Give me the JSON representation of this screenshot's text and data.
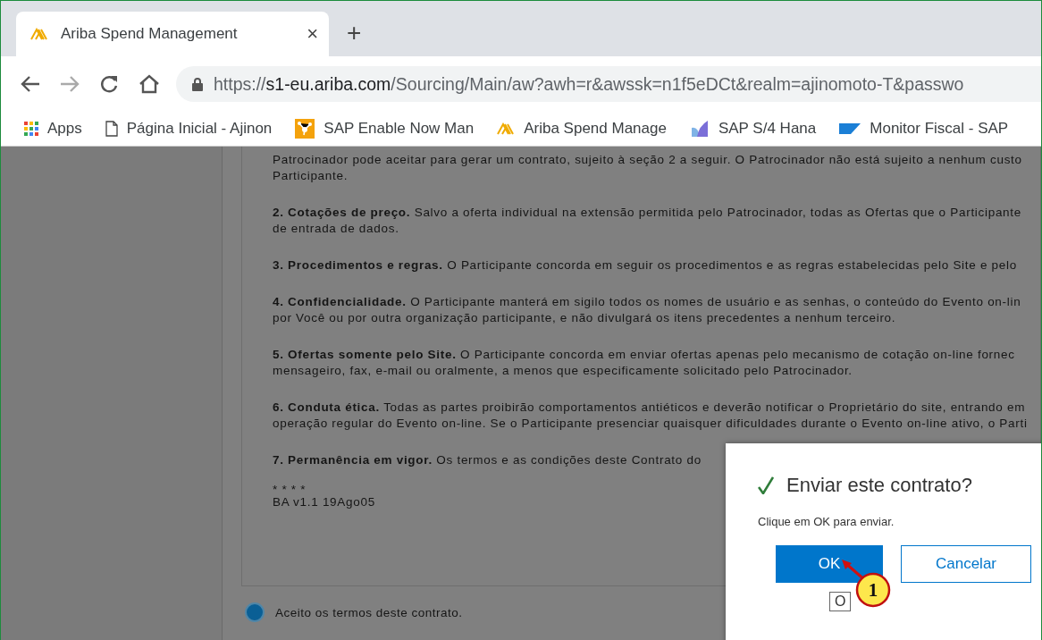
{
  "browser": {
    "tabs": [
      {
        "title": "Ariba Spend Management",
        "selected": true,
        "close": "×"
      }
    ],
    "new_tab": "+",
    "url": {
      "scheme": "https://",
      "host": "s1-eu.ariba.com",
      "path": "/Sourcing/Main/aw?awh=r&awssk=n1f5eDCt&realm=ajinomoto-T&passwo"
    },
    "bookmarks": [
      {
        "kind": "apps",
        "label": "Apps"
      },
      {
        "kind": "page",
        "label": "Página Inicial - Ajinon"
      },
      {
        "kind": "enable",
        "label": "SAP Enable Now Man"
      },
      {
        "kind": "ariba",
        "label": "Ariba Spend Manage"
      },
      {
        "kind": "hana",
        "label": "SAP S/4 Hana"
      },
      {
        "kind": "sap",
        "label": "Monitor Fiscal - SAP"
      }
    ]
  },
  "contract": {
    "paragraphs": [
      [
        "Patrocinador pode aceitar para gerar um contrato, sujeito à seção 2 a seguir. O Patrocinador não está sujeito a nenhum custo",
        "Participante."
      ],
      [
        "**2. Cotações de preço.** Salvo a oferta individual na extensão permitida pelo Patrocinador, todas as Ofertas que o Participante",
        "de entrada de dados."
      ],
      [
        "**3. Procedimentos e regras.** O Participante concorda em seguir os procedimentos e as regras estabelecidas pelo Site e pelo"
      ],
      [
        "**4. Confidencialidade.** O Participante manterá em sigilo todos os nomes de usuário e as senhas, o conteúdo do Evento on-lin",
        "por Você ou por outra organização participante, e não divulgará os itens precedentes a nenhum terceiro."
      ],
      [
        "**5. Ofertas somente pelo Site.** O Participante concorda em enviar ofertas apenas pelo mecanismo de cotação on-line fornec",
        "mensageiro, fax, e-mail ou oralmente, a menos que especificamente solicitado pelo Patrocinador."
      ],
      [
        "**6. Conduta ética.** Todas as partes proibirão comportamentos antiéticos e deverão notificar o Proprietário do site, entrando em",
        "operação regular do Evento on-line. Se o Participante presenciar quaisquer dificuldades durante o Evento on-line ativo, o Parti"
      ],
      [
        "**7. Permanência em vigor.** Os termos e as condições deste Contrato do"
      ],
      [
        "* * * *",
        "BA v1.1 19Ago05"
      ]
    ],
    "accept": {
      "label": "Aceito os termos deste contrato.",
      "selected": true
    }
  },
  "dialog": {
    "title": "Enviar este contrato?",
    "message": "Clique em OK para enviar.",
    "ok": "OK",
    "cancel": "Cancelar",
    "tooltip": "O",
    "callout": "1"
  }
}
